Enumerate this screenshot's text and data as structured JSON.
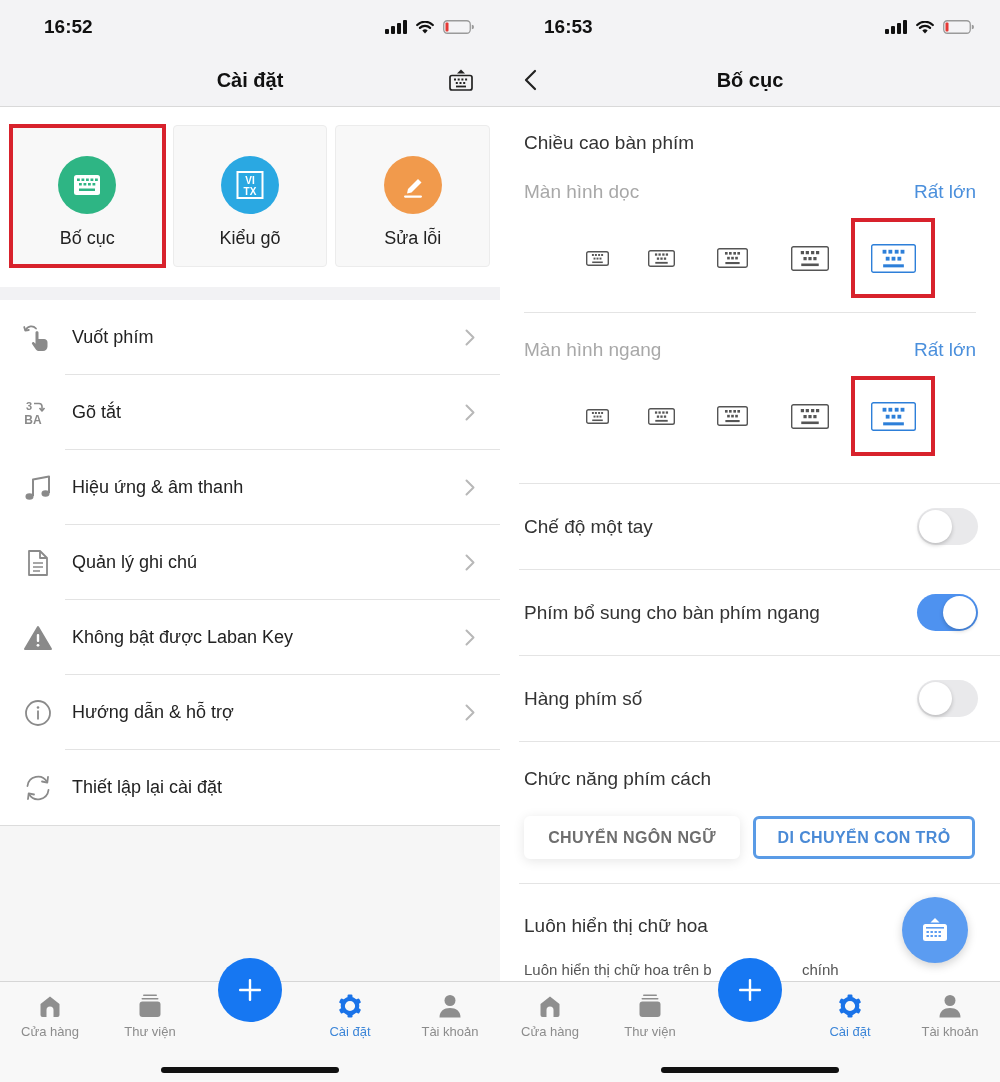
{
  "screens": [
    {
      "kind": "settings_home",
      "status_bar": {
        "time": "16:52"
      },
      "nav_bar": {
        "title": "Cài đặt",
        "keyboard_button": true
      },
      "feature_cards": [
        {
          "label": "Bố cục",
          "color": "#2eb584",
          "highlighted": true
        },
        {
          "label": "Kiểu gõ",
          "color": "#2aa8e2",
          "highlighted": false,
          "icon_text": [
            "VI",
            "TX"
          ]
        },
        {
          "label": "Sửa lỗi",
          "color": "#f19a4c",
          "highlighted": false
        }
      ],
      "menu_items": [
        {
          "label": "Vuốt phím",
          "chevron": true
        },
        {
          "label": "Gõ tắt",
          "chevron": true,
          "icon_text": [
            "3",
            "BA"
          ]
        },
        {
          "label": "Hiệu ứng & âm thanh",
          "chevron": true
        },
        {
          "label": "Quản lý ghi chú",
          "chevron": true
        },
        {
          "label": "Không bật được Laban Key",
          "chevron": true
        },
        {
          "label": "Hướng dẫn & hỗ trợ",
          "chevron": true
        },
        {
          "label": "Thiết lập lại cài đặt",
          "chevron": false
        }
      ],
      "tab_bar": {
        "items": [
          {
            "label": "Cửa hàng",
            "selected": false
          },
          {
            "label": "Thư viện",
            "selected": false
          },
          {
            "label": "Cài đặt",
            "selected": true
          },
          {
            "label": "Tài khoản",
            "selected": false
          }
        ]
      }
    },
    {
      "kind": "layout_settings",
      "status_bar": {
        "time": "16:53"
      },
      "nav_bar": {
        "title": "Bố cục",
        "back_button": true
      },
      "section_title": "Chiều cao bàn phím",
      "height_groups": [
        {
          "label": "Màn hình dọc",
          "value": "Rất lớn",
          "options": [
            {
              "selected": false,
              "highlighted": false
            },
            {
              "selected": false,
              "highlighted": false
            },
            {
              "selected": false,
              "highlighted": false
            },
            {
              "selected": false,
              "highlighted": false
            },
            {
              "selected": true,
              "highlighted": true
            }
          ]
        },
        {
          "label": "Màn hình ngang",
          "value": "Rất lớn",
          "options": [
            {
              "selected": false,
              "highlighted": false
            },
            {
              "selected": false,
              "highlighted": false
            },
            {
              "selected": false,
              "highlighted": false
            },
            {
              "selected": false,
              "highlighted": false
            },
            {
              "selected": true,
              "highlighted": true
            }
          ]
        }
      ],
      "toggles": [
        {
          "label": "Chế độ một tay",
          "on": false
        },
        {
          "label": "Phím bổ sung cho bàn phím ngang",
          "on": true
        },
        {
          "label": "Hàng phím số",
          "on": false
        }
      ],
      "space_key": {
        "label": "Chức năng phím cách",
        "options": [
          {
            "label": "CHUYỂN NGÔN NGỮ",
            "selected": false
          },
          {
            "label": "DI CHUYỂN CON TRỎ",
            "selected": true
          }
        ]
      },
      "caps_setting": {
        "label": "Luôn hiển thị chữ hoa",
        "hint_parts": [
          "Luôn hiển thị chữ hoa trên b",
          "chính"
        ]
      },
      "tab_bar": {
        "items": [
          {
            "label": "Cửa hàng",
            "selected": false
          },
          {
            "label": "Thư viện",
            "selected": false
          },
          {
            "label": "Cài đặt",
            "selected": true
          },
          {
            "label": "Tài khoản",
            "selected": false
          }
        ]
      }
    }
  ]
}
